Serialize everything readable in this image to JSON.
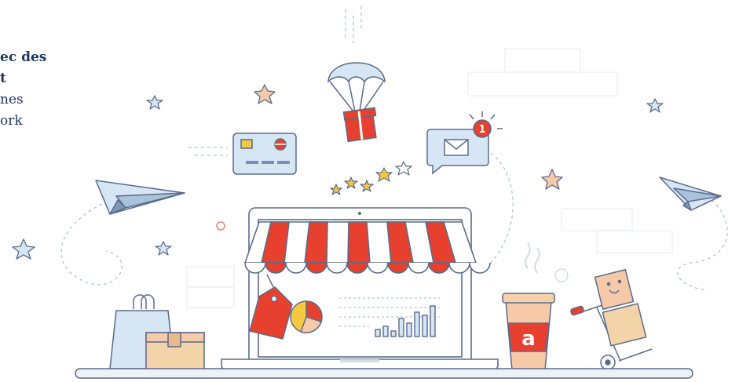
{
  "text_block": {
    "line1": "ec des",
    "line2": "t",
    "line3": "nes",
    "line4": "ork"
  },
  "mug": {
    "logo_letter": "a"
  },
  "notification": {
    "count": "1"
  },
  "colors": {
    "red": "#e8402e",
    "navy": "#1f3564",
    "outline": "#5a6b8c",
    "light_blue": "#d6e6f4",
    "peach": "#f6c9a9",
    "yellow": "#f5c842",
    "cardboard": "#f3d3a8"
  },
  "icons": [
    "parachute-gift-icon",
    "credit-card-icon",
    "mail-notification-icon",
    "paper-plane-icon",
    "rating-stars-icon",
    "shopping-bag-icon",
    "cardboard-box-icon",
    "price-tag-icon",
    "pie-chart-icon",
    "bar-chart-icon",
    "coffee-cup-icon",
    "hand-truck-icon",
    "store-awning-icon"
  ]
}
